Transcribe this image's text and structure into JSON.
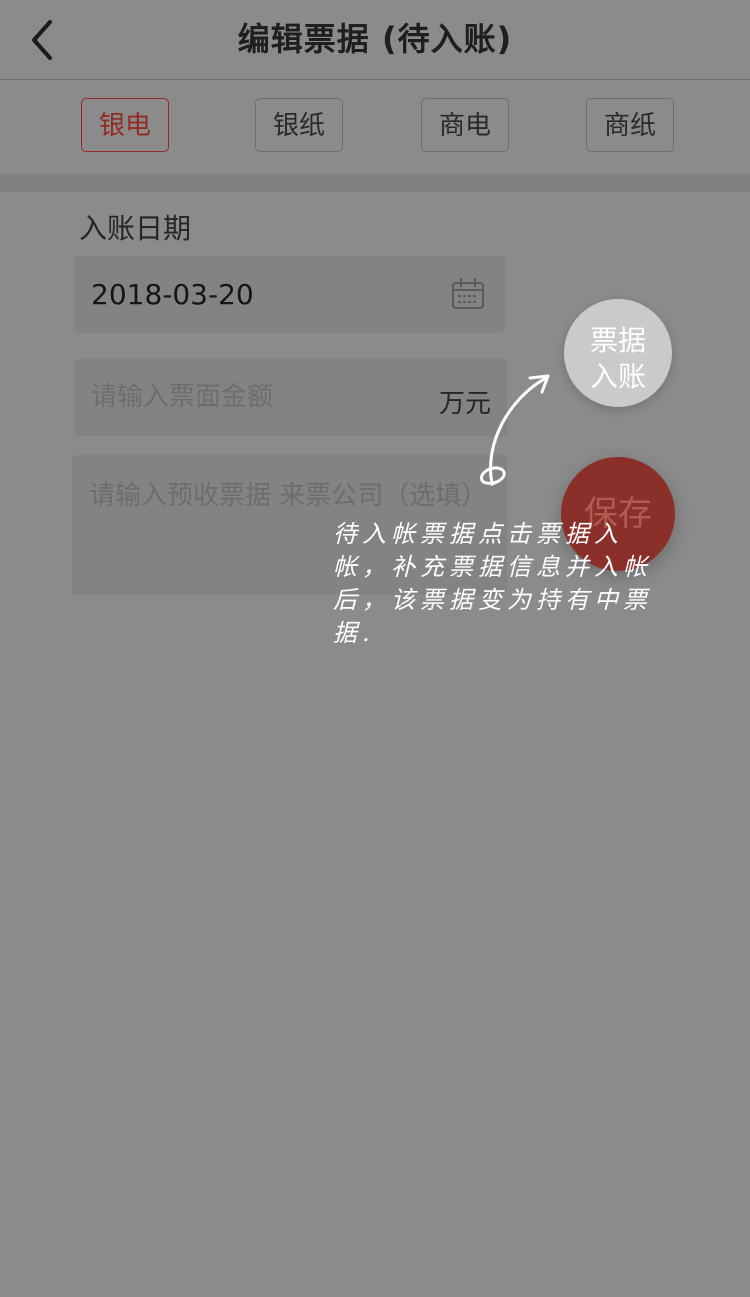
{
  "header": {
    "title": "编辑票据 (待入账)"
  },
  "tabs": [
    {
      "label": "银电",
      "active": true
    },
    {
      "label": "银纸",
      "active": false
    },
    {
      "label": "商电",
      "active": false
    },
    {
      "label": "商纸",
      "active": false
    }
  ],
  "form": {
    "date_label": "入账日期",
    "date_value": "2018-03-20",
    "amount_placeholder": "请输入票面金额",
    "amount_unit": "万元",
    "note_placeholder": "请输入预收票据 来票公司（选填）"
  },
  "fab": {
    "ticket_line1": "票据",
    "ticket_line2": "入账",
    "save_label": "保存"
  },
  "guide": {
    "text": "待入帐票据点击票据入帐，补充票据信息并入帐后，该票据变为持有中票据."
  },
  "colors": {
    "overlay_bg": "#8b8b8b",
    "accent": "#942a24",
    "fab_ticket": "#cacaca",
    "fab_save": "#8a2f2a",
    "guide_text": "#ffffff"
  },
  "icons": {
    "back": "chevron-left-icon",
    "calendar": "calendar-icon",
    "guide_arrow": "curved-arrow-icon"
  }
}
